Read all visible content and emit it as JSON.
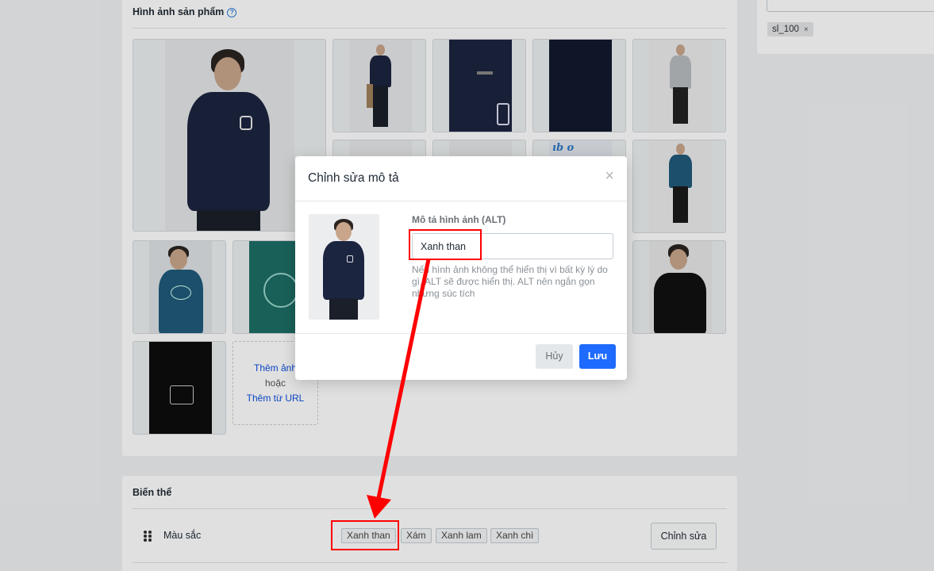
{
  "product_images": {
    "title": "Hình ảnh sản phẩm",
    "add_image_label": "Thêm ảnh",
    "or_label": "hoặc",
    "add_from_url_label": "Thêm từ URL"
  },
  "tags": {
    "items": [
      {
        "label": "sl_100"
      }
    ]
  },
  "variants": {
    "title": "Biến thể",
    "option_name": "Màu sắc",
    "values": [
      "Xanh than",
      "Xám",
      "Xanh lam",
      "Xanh chì"
    ],
    "edit_label": "Chỉnh sửa"
  },
  "modal": {
    "title": "Chỉnh sửa mô tả",
    "close_glyph": "×",
    "alt_label": "Mô tả hình ảnh (ALT)",
    "alt_value": "Xanh than",
    "help_text": "Nếu hình ảnh không thể hiển thị vì bất kỳ lý do gì, ALT sẽ được hiển thị. ALT nên ngắn gọn nhưng súc tích",
    "cancel_label": "Hủy",
    "save_label": "Lưu"
  },
  "colors": {
    "primary_button": "#1f6bff",
    "annotation_red": "#ff0000",
    "link_blue": "#0d4ee0",
    "navy_shirt": "#1c2540",
    "teal_shirt": "#1f5a7a"
  }
}
